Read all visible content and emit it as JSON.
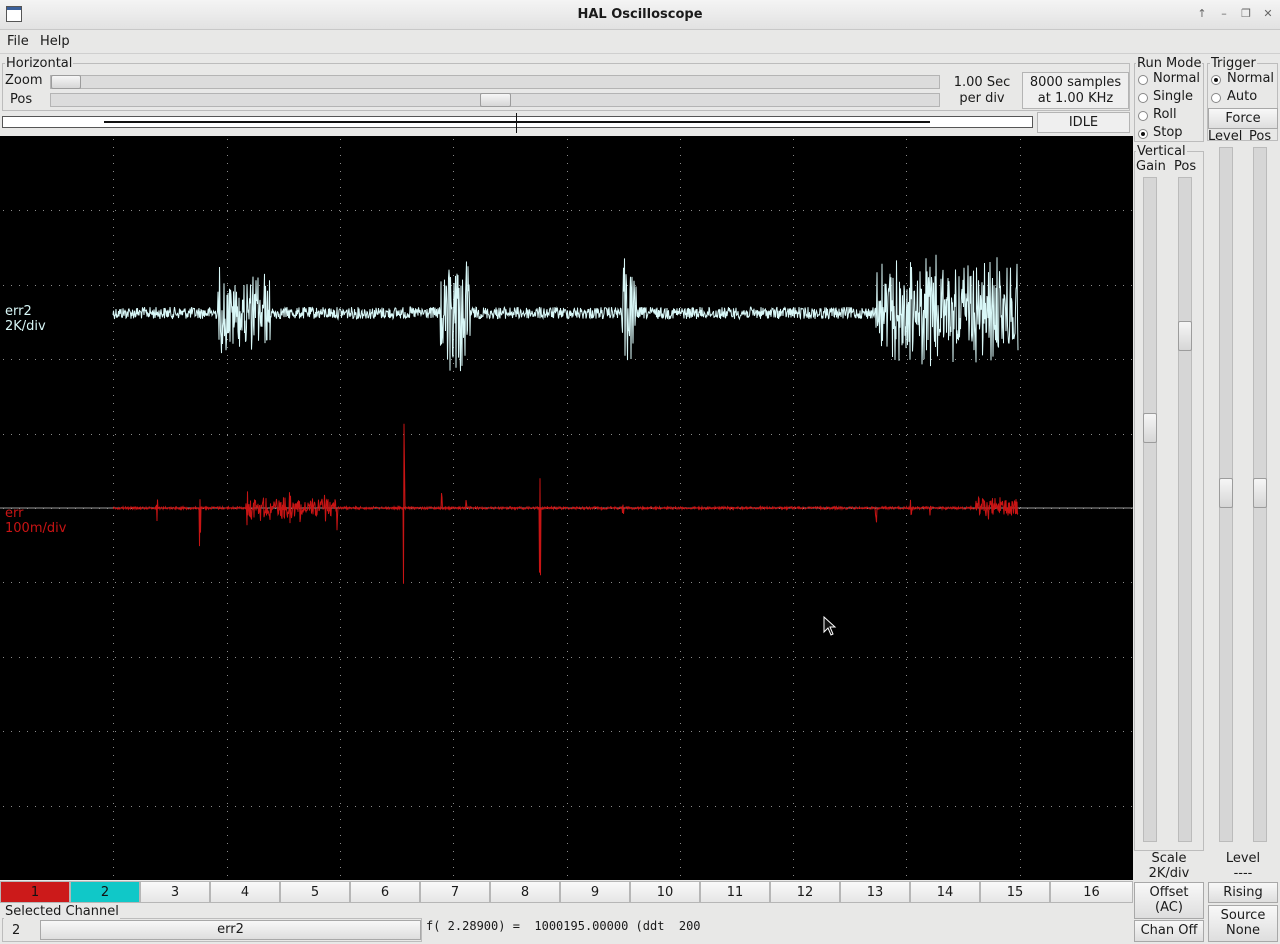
{
  "window": {
    "title": "HAL Oscilloscope",
    "buttons": [
      "↑",
      "–",
      "❐",
      "✕"
    ]
  },
  "menu": {
    "file": "File",
    "help": "Help"
  },
  "horizontal": {
    "label": "Horizontal",
    "zoom_label": "Zoom",
    "pos_label": "Pos",
    "zoom_value": 0.0,
    "pos_value": 0.5,
    "rate": "1.00 Sec",
    "rate_unit": "per div",
    "samples": "8000 samples",
    "samples_rate": "at 1.00 KHz",
    "status": "IDLE"
  },
  "run_mode": {
    "label": "Run Mode",
    "options": [
      "Normal",
      "Single",
      "Roll",
      "Stop"
    ],
    "selected": "Stop"
  },
  "trigger": {
    "label": "Trigger",
    "options": [
      "Normal",
      "Auto"
    ],
    "selected": "Normal",
    "force": "Force",
    "level_label": "Level",
    "pos_label": "Pos",
    "level_caption": "Level",
    "level_value": "----",
    "edge": "Rising",
    "source_label": "Source",
    "source_value": "None"
  },
  "vertical": {
    "label": "Vertical",
    "gain_label": "Gain",
    "pos_label": "Pos",
    "scale_label": "Scale",
    "scale_value": "2K/div",
    "offset_label": "Offset",
    "offset_mode": "(AC)",
    "chan_off": "Chan Off"
  },
  "traces": [
    {
      "name": "err2",
      "scale": "2K/div",
      "color": "#d8f7f7"
    },
    {
      "name": "err",
      "scale": "100m/div",
      "color": "#c81414"
    }
  ],
  "channels": [
    "1",
    "2",
    "3",
    "4",
    "5",
    "6",
    "7",
    "8",
    "9",
    "10",
    "11",
    "12",
    "13",
    "14",
    "15",
    "16"
  ],
  "channel_colors": {
    "1": "#cc1a1a",
    "2": "#10c8c8"
  },
  "selected_channel": {
    "label": "Selected Channel",
    "number": "2",
    "name": "err2"
  },
  "readout": "f( 2.28900) =  1000195.00000 (ddt  200"
}
